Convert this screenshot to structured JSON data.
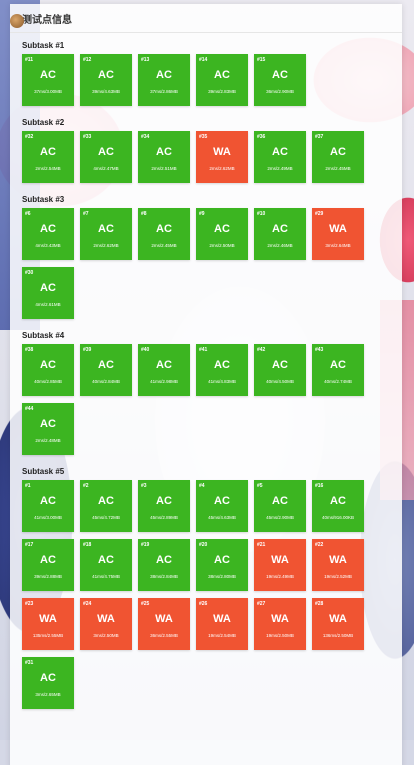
{
  "panel": {
    "title": "测试点信息"
  },
  "colors": {
    "ac": "#3cb521",
    "wa": "#f05432"
  },
  "subtasks": [
    {
      "title": "Subtask #1",
      "cases": [
        {
          "id": "#11",
          "verdict": "AC",
          "stats": "37ms/3.00MB"
        },
        {
          "id": "#12",
          "verdict": "AC",
          "stats": "39ms/4.63MB"
        },
        {
          "id": "#13",
          "verdict": "AC",
          "stats": "37ms/2.86MB"
        },
        {
          "id": "#14",
          "verdict": "AC",
          "stats": "39ms/2.83MB"
        },
        {
          "id": "#15",
          "verdict": "AC",
          "stats": "36ms/2.90MB"
        }
      ]
    },
    {
      "title": "Subtask #2",
      "cases": [
        {
          "id": "#32",
          "verdict": "AC",
          "stats": "2ms/2.54MB"
        },
        {
          "id": "#33",
          "verdict": "AC",
          "stats": "4ms/2.47MB"
        },
        {
          "id": "#34",
          "verdict": "AC",
          "stats": "2ms/2.51MB"
        },
        {
          "id": "#35",
          "verdict": "WA",
          "stats": "2ms/2.62MB"
        },
        {
          "id": "#36",
          "verdict": "AC",
          "stats": "2ms/2.49MB"
        },
        {
          "id": "#37",
          "verdict": "AC",
          "stats": "2ms/2.45MB"
        }
      ]
    },
    {
      "title": "Subtask #3",
      "cases": [
        {
          "id": "#6",
          "verdict": "AC",
          "stats": "4ms/3.43MB"
        },
        {
          "id": "#7",
          "verdict": "AC",
          "stats": "2ms/2.62MB"
        },
        {
          "id": "#8",
          "verdict": "AC",
          "stats": "2ms/2.45MB"
        },
        {
          "id": "#9",
          "verdict": "AC",
          "stats": "2ms/2.50MB"
        },
        {
          "id": "#10",
          "verdict": "AC",
          "stats": "2ms/2.46MB"
        },
        {
          "id": "#29",
          "verdict": "WA",
          "stats": "3ms/2.64MB"
        },
        {
          "id": "#30",
          "verdict": "AC",
          "stats": "4ms/2.61MB"
        }
      ]
    },
    {
      "title": "Subtask #4",
      "cases": [
        {
          "id": "#38",
          "verdict": "AC",
          "stats": "40ms/2.85MB"
        },
        {
          "id": "#39",
          "verdict": "AC",
          "stats": "40ms/2.84MB"
        },
        {
          "id": "#40",
          "verdict": "AC",
          "stats": "41ms/2.98MB"
        },
        {
          "id": "#41",
          "verdict": "AC",
          "stats": "41ms/4.83MB"
        },
        {
          "id": "#42",
          "verdict": "AC",
          "stats": "40ms/4.50MB"
        },
        {
          "id": "#43",
          "verdict": "AC",
          "stats": "40ms/2.74MB"
        },
        {
          "id": "#44",
          "verdict": "AC",
          "stats": "2ms/2.48MB"
        }
      ]
    },
    {
      "title": "Subtask #5",
      "cases": [
        {
          "id": "#1",
          "verdict": "AC",
          "stats": "41ms/3.00MB"
        },
        {
          "id": "#2",
          "verdict": "AC",
          "stats": "45ms/4.72MB"
        },
        {
          "id": "#3",
          "verdict": "AC",
          "stats": "45ms/2.89MB"
        },
        {
          "id": "#4",
          "verdict": "AC",
          "stats": "45ms/4.63MB"
        },
        {
          "id": "#5",
          "verdict": "AC",
          "stats": "45ms/2.90MB"
        },
        {
          "id": "#16",
          "verdict": "AC",
          "stats": "40ms/916.00KB"
        },
        {
          "id": "#17",
          "verdict": "AC",
          "stats": "39ms/2.88MB"
        },
        {
          "id": "#18",
          "verdict": "AC",
          "stats": "41ms/4.75MB"
        },
        {
          "id": "#19",
          "verdict": "AC",
          "stats": "38ms/2.84MB"
        },
        {
          "id": "#20",
          "verdict": "AC",
          "stats": "38ms/2.80MB"
        },
        {
          "id": "#21",
          "verdict": "WA",
          "stats": "19ms/2.49MB"
        },
        {
          "id": "#22",
          "verdict": "WA",
          "stats": "19ms/2.52MB"
        },
        {
          "id": "#23",
          "verdict": "WA",
          "stats": "135ms/2.55MB"
        },
        {
          "id": "#24",
          "verdict": "WA",
          "stats": "3ms/2.50MB"
        },
        {
          "id": "#25",
          "verdict": "WA",
          "stats": "36ms/2.55MB"
        },
        {
          "id": "#26",
          "verdict": "WA",
          "stats": "19ms/2.54MB"
        },
        {
          "id": "#27",
          "verdict": "WA",
          "stats": "19ms/2.50MB"
        },
        {
          "id": "#28",
          "verdict": "WA",
          "stats": "136ms/2.50MB"
        },
        {
          "id": "#31",
          "verdict": "AC",
          "stats": "3ms/2.65MB"
        }
      ]
    }
  ]
}
